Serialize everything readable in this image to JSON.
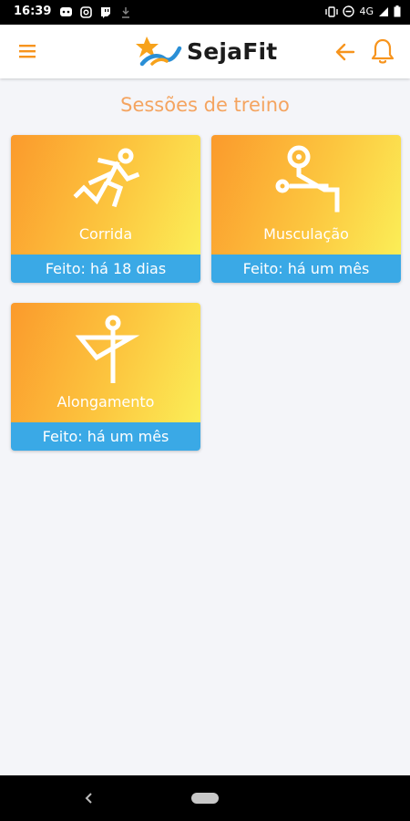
{
  "status_bar": {
    "time": "16:39",
    "network": "4G"
  },
  "app_bar": {
    "brand": "SejaFit",
    "brand_colors": {
      "orange": "#f7a21b",
      "blue": "#2a8fd6"
    }
  },
  "page": {
    "title": "Sessões de treino"
  },
  "cards": [
    {
      "label": "Corrida",
      "status": "Feito: há 18 dias",
      "icon": "running-icon"
    },
    {
      "label": "Musculação",
      "status": "Feito: há um mês",
      "icon": "bench-press-icon"
    },
    {
      "label": "Alongamento",
      "status": "Feito: há um mês",
      "icon": "stretching-icon"
    }
  ],
  "colors": {
    "accent": "#f7941d",
    "card_footer": "#3aa9e6",
    "title": "#f4a460",
    "background": "#f4f5f9"
  }
}
